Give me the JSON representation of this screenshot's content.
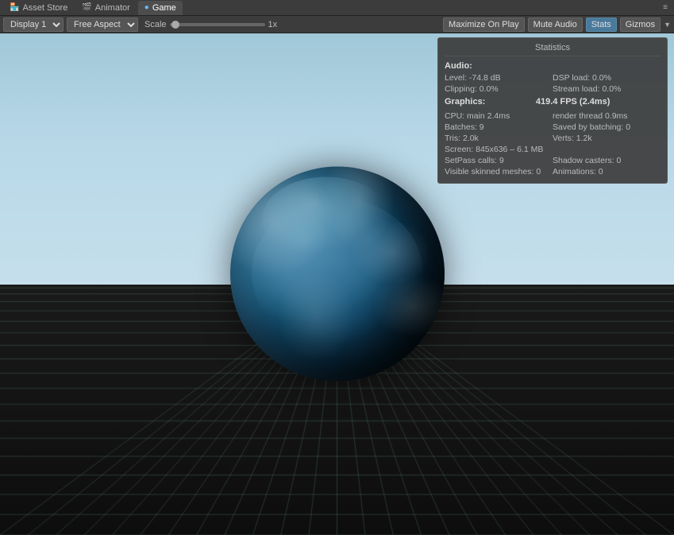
{
  "tabs": [
    {
      "id": "asset-store",
      "label": "Asset Store",
      "icon": "store-icon",
      "active": false
    },
    {
      "id": "animator",
      "label": "Animator",
      "icon": "animator-icon",
      "active": false
    },
    {
      "id": "game",
      "label": "Game",
      "icon": "game-icon",
      "active": true
    }
  ],
  "tab_menu_label": "≡",
  "toolbar": {
    "display_label": "Display 1",
    "aspect_label": "Free Aspect",
    "scale_label": "Scale",
    "scale_value": "1x",
    "maximize_label": "Maximize On Play",
    "mute_label": "Mute Audio",
    "stats_label": "Stats",
    "gizmos_label": "Gizmos"
  },
  "stats": {
    "title": "Statistics",
    "audio_header": "Audio:",
    "level_label": "Level: -74.8 dB",
    "dsp_label": "DSP load: 0.0%",
    "clipping_label": "Clipping: 0.0%",
    "stream_label": "Stream load: 0.0%",
    "graphics_header": "Graphics:",
    "fps_label": "419.4 FPS (2.4ms)",
    "cpu_label": "CPU: main 2.4ms",
    "render_label": "render thread 0.9ms",
    "batches_label": "Batches: 9",
    "saved_label": "Saved by batching: 0",
    "tris_label": "Tris: 2.0k",
    "verts_label": "Verts: 1.2k",
    "screen_label": "Screen: 845x636 – 6.1 MB",
    "setpass_label": "SetPass calls: 9",
    "shadow_label": "Shadow casters: 0",
    "visible_label": "Visible skinned meshes: 0",
    "animations_label": "Animations: 0"
  }
}
